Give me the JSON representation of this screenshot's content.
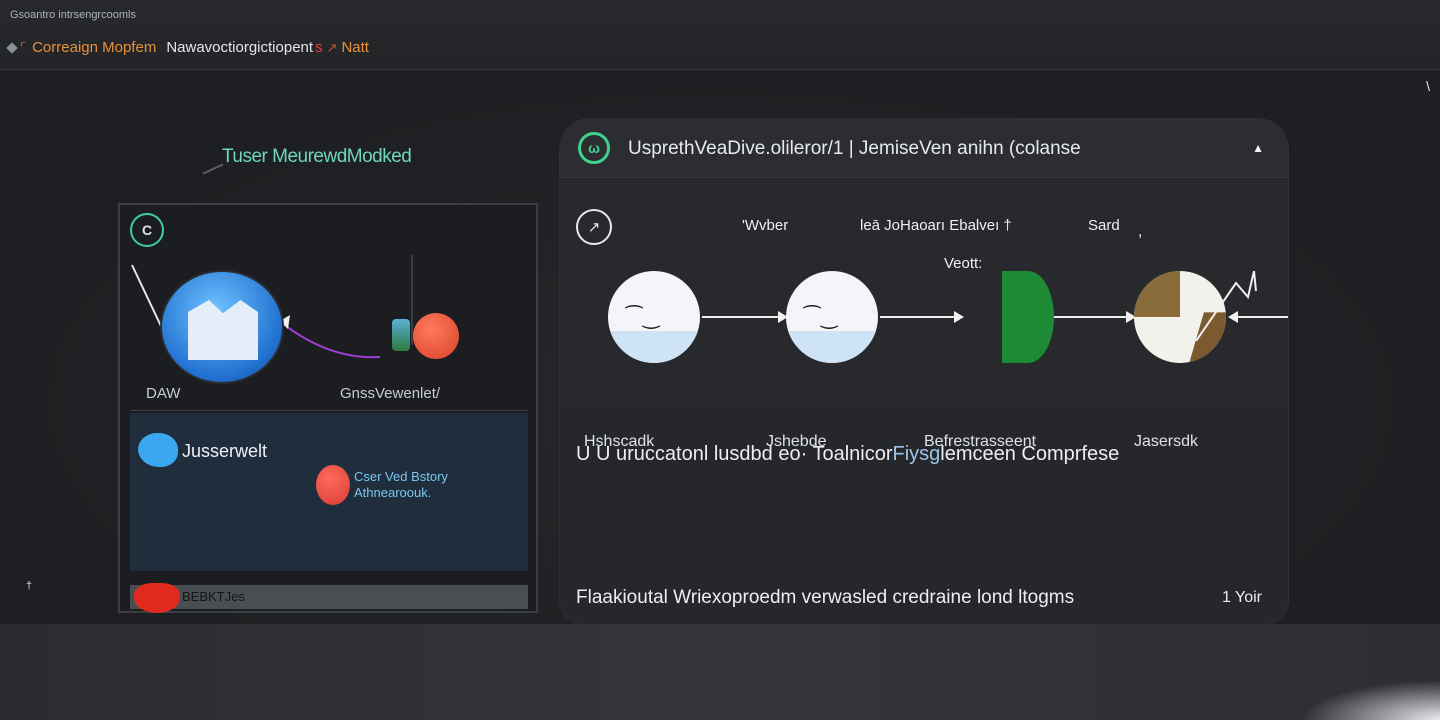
{
  "window": {
    "tiny_title": "Gsoantro intrsengrcoomls"
  },
  "breadcrumb": {
    "c1": "Correaign Mopfem",
    "c2": "Nawavoctiorgictiopent",
    "c3": "s",
    "c4": "Natt"
  },
  "corner_mark": "\\",
  "left_panel": {
    "title": "Tuser MeurewdModked",
    "icon_glyph": "C",
    "label_left": "DAW",
    "label_right": "GnssVewenlet/",
    "user_label": "Jusserwelt",
    "note_line1": "Cser Ved Bstory",
    "note_line2": "Athnearoouk.",
    "footer_label": "BEBKTJes"
  },
  "side_mark": "†",
  "right_panel": {
    "logo_glyph": "ω",
    "title": "UsprethVeaDive.olileror/1 | JemiseVen anihn (colanse",
    "collapse_glyph": "▲",
    "flow": {
      "head_icon_glyph": "↗",
      "top_labels": [
        "'Wvber",
        "leā JoHaoarı Ebalveı †",
        "Sard",
        ","
      ],
      "sub_label": "Veott:",
      "nodes": [
        {
          "label": "Hshscadk",
          "face": "⁀‿"
        },
        {
          "label": "Jshebde",
          "face": "⁀‿"
        },
        {
          "label": "Befrestrasseent",
          "face": ""
        },
        {
          "label": "Jasersdk",
          "face": ""
        }
      ]
    },
    "line1_prefix": "U U",
    "line1_main": "uruccatonl lusdbd eo· Toalnicor",
    "line1_highlight": "Fiysg",
    "line1_suffix": "lemceen Comprfese",
    "line2": "Flaakioutal Wriexoproedm verwasled credraine lond ltogms",
    "page_number": "1 Yoir"
  },
  "colors": {
    "accent_green": "#3fd28f",
    "accent_orange": "#e8913a",
    "accent_red": "#e2452b",
    "panel_bg": "#25272b"
  }
}
